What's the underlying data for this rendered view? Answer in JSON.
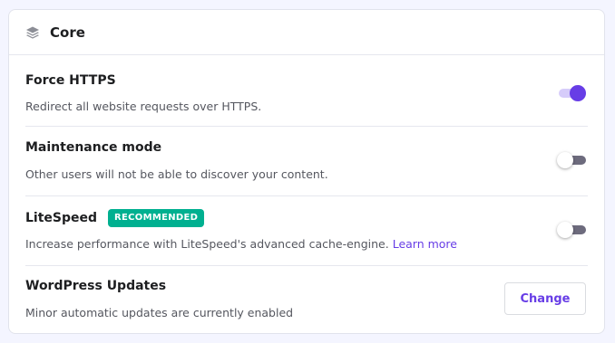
{
  "card": {
    "title": "Core",
    "icon": "layers-icon"
  },
  "settings": [
    {
      "title": "Force HTTPS",
      "description": "Redirect all website requests over HTTPS.",
      "control": "toggle",
      "enabled": true
    },
    {
      "title": "Maintenance mode",
      "description": "Other users will not be able to discover your content.",
      "control": "toggle",
      "enabled": false
    },
    {
      "title": "LiteSpeed",
      "badge": "RECOMMENDED",
      "description": "Increase performance with LiteSpeed's advanced cache-engine.",
      "link_text": "Learn more",
      "control": "toggle",
      "enabled": false
    },
    {
      "title": "WordPress Updates",
      "description": "Minor automatic updates are currently enabled",
      "control": "button",
      "button_label": "Change"
    }
  ],
  "colors": {
    "accent": "#673de6",
    "badge": "#00b090",
    "toggle_off_track": "#6d6b7d"
  }
}
